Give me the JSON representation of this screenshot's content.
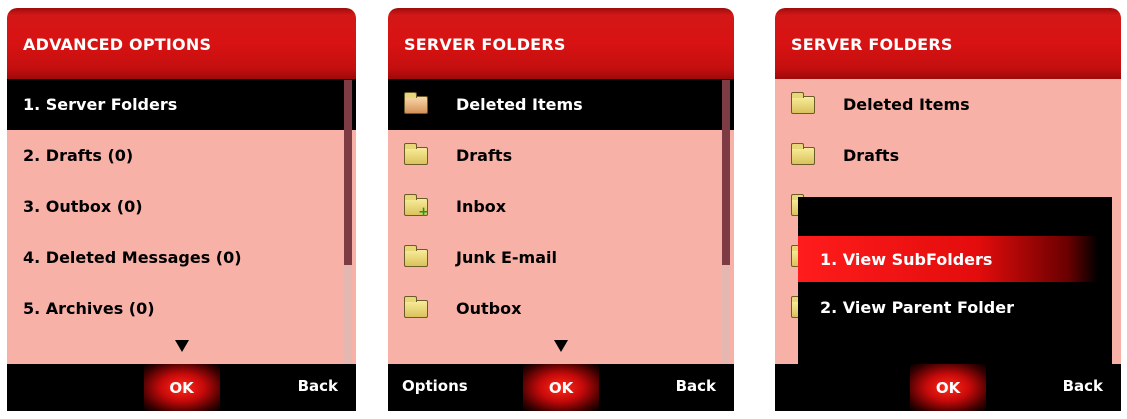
{
  "screens": [
    {
      "title": "ADVANCED OPTIONS",
      "items": [
        {
          "label": "1. Server Folders",
          "selected": true
        },
        {
          "label": "2. Drafts (0)",
          "selected": false
        },
        {
          "label": "3. Outbox (0)",
          "selected": false
        },
        {
          "label": "4. Deleted Messages (0)",
          "selected": false
        },
        {
          "label": "5. Archives (0)",
          "selected": false
        }
      ],
      "softkeys": {
        "left": "",
        "center": "OK",
        "right": "Back"
      }
    },
    {
      "title": "SERVER FOLDERS",
      "items": [
        {
          "label": "Deleted Items",
          "icon": "open-folder-icon",
          "selected": true
        },
        {
          "label": "Drafts",
          "icon": "folder-icon",
          "selected": false
        },
        {
          "label": "Inbox",
          "icon": "inbox-folder-icon",
          "selected": false
        },
        {
          "label": "Junk E-mail",
          "icon": "folder-icon",
          "selected": false
        },
        {
          "label": "Outbox",
          "icon": "folder-icon",
          "selected": false
        }
      ],
      "softkeys": {
        "left": "Options",
        "center": "OK",
        "right": "Back"
      }
    },
    {
      "title": "SERVER FOLDERS",
      "items": [
        {
          "label": "Deleted Items",
          "icon": "folder-icon"
        },
        {
          "label": "Drafts",
          "icon": "folder-icon"
        }
      ],
      "popup": [
        {
          "label": "1. View SubFolders",
          "selected": true
        },
        {
          "label": "2. View Parent Folder",
          "selected": false
        }
      ],
      "softkeys": {
        "left": "",
        "center": "OK",
        "right": "Back"
      }
    }
  ],
  "colors": {
    "titlebar": "#d41717",
    "list_background": "#f7b1a7",
    "selection": "#000000",
    "scroll_thumb": "#7d3b44"
  }
}
